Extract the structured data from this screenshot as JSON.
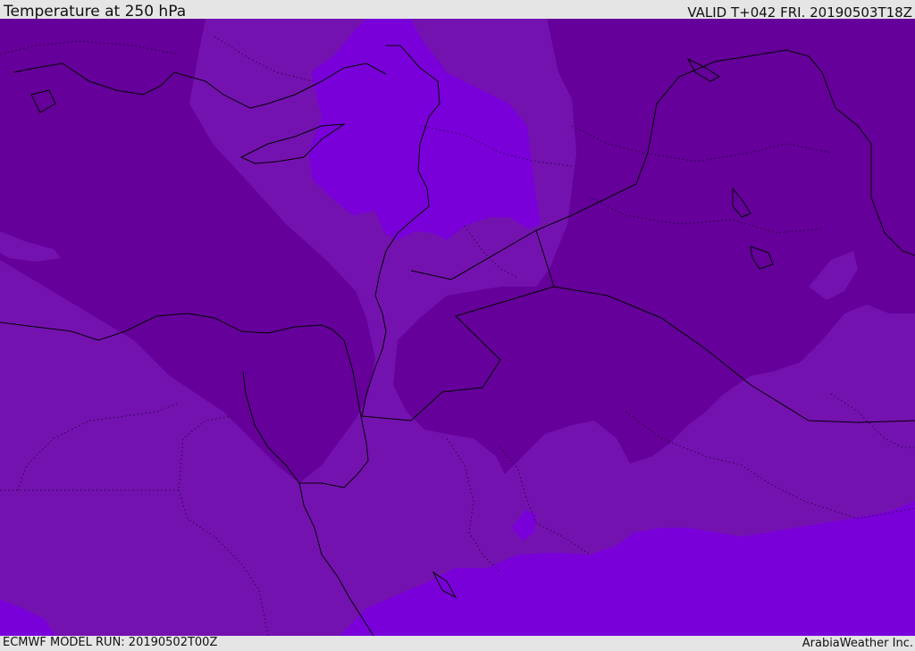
{
  "header": {
    "title": "Temperature at 250 hPa",
    "valid": "VALID T+042 FRI. 20190503T18Z"
  },
  "footer": {
    "model_run": "ECMWF MODEL RUN: 20190502T00Z",
    "credit": "ArabiaWeather Inc."
  },
  "colors": {
    "cold": "#65009a",
    "cool": "#7412b0",
    "mild": "#7a00da",
    "border": "#000000"
  }
}
